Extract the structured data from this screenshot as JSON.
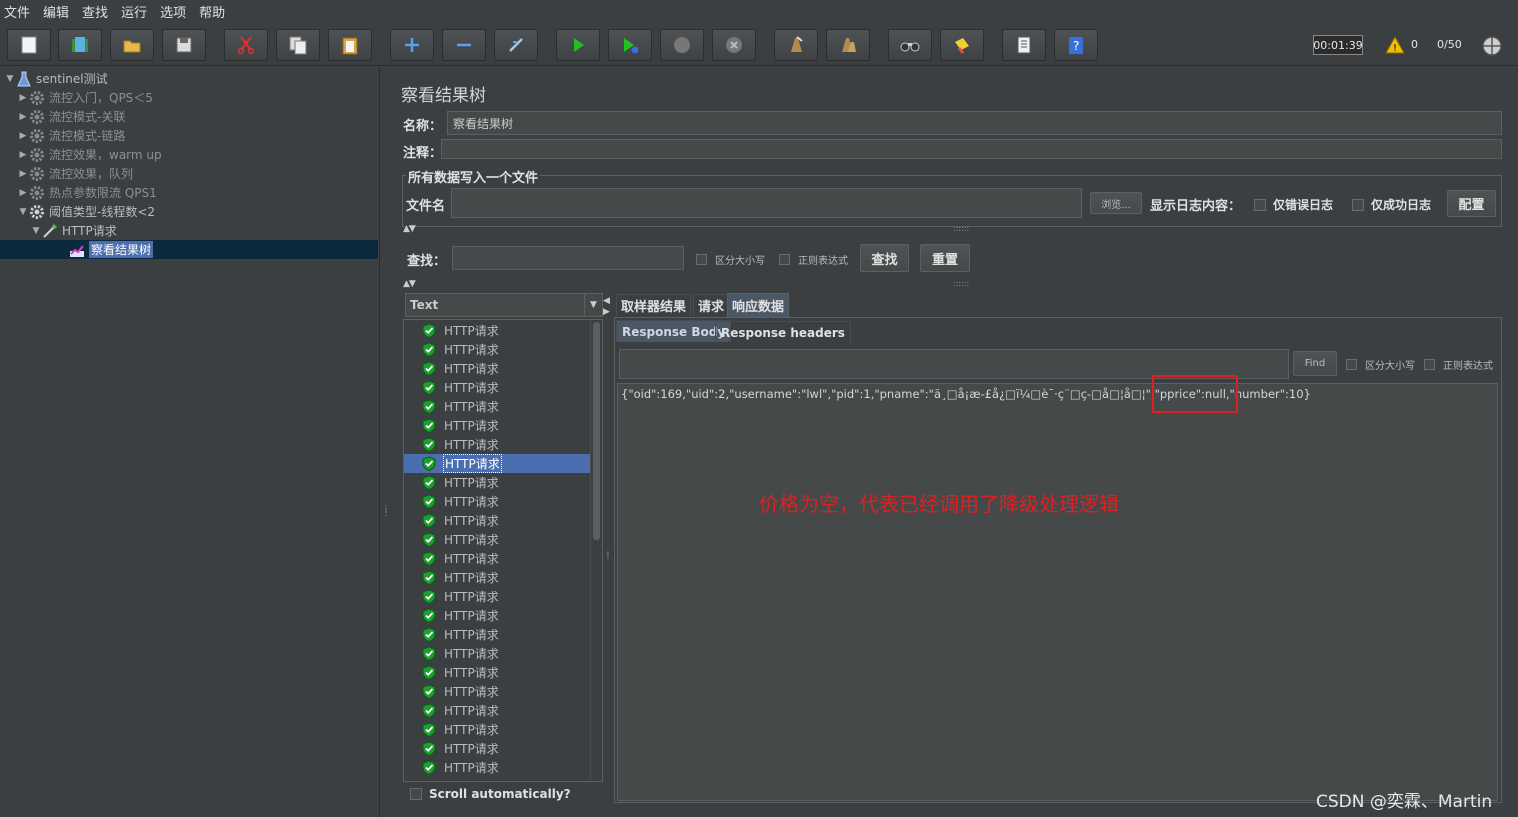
{
  "menu": [
    "文件",
    "编辑",
    "查找",
    "运行",
    "选项",
    "帮助"
  ],
  "toolbar": {
    "buttons": [
      "new-icon",
      "templates-icon",
      "open-icon",
      "save-icon",
      "cut-icon",
      "copy-icon",
      "paste-icon",
      "expand-icon",
      "collapse-icon",
      "toggle-icon",
      "start-icon",
      "start-no-pause-icon",
      "stop-icon",
      "shutdown-icon",
      "clear-icon",
      "clear-all-icon",
      "search-icon",
      "reset-search-icon",
      "function-helper-icon",
      "help-icon"
    ],
    "timer": "00:01:39",
    "warning_count": "0",
    "threads": "0/50",
    "colors": {
      "accent_green": "#20c020",
      "warning": "#f0c000",
      "help_blue": "#3a6fd8"
    }
  },
  "tree": [
    {
      "label": "sentinel测试",
      "level": 0,
      "expanded": true,
      "icon": "flask-icon",
      "disabled": false
    },
    {
      "label": "流控入门，QPS＜5",
      "level": 1,
      "expanded": false,
      "icon": "gear-icon",
      "disabled": true
    },
    {
      "label": "流控模式-关联",
      "level": 1,
      "expanded": false,
      "icon": "gear-icon",
      "disabled": true
    },
    {
      "label": "流控模式-链路",
      "level": 1,
      "expanded": false,
      "icon": "gear-icon",
      "disabled": true
    },
    {
      "label": "流控效果，warm up",
      "level": 1,
      "expanded": false,
      "icon": "gear-icon",
      "disabled": true
    },
    {
      "label": "流控效果，队列",
      "level": 1,
      "expanded": false,
      "icon": "gear-icon",
      "disabled": true
    },
    {
      "label": "热点参数限流 QPS1",
      "level": 1,
      "expanded": false,
      "icon": "gear-icon",
      "disabled": true
    },
    {
      "label": "阈值类型-线程数<2",
      "level": 1,
      "expanded": true,
      "icon": "gear-icon",
      "disabled": false
    },
    {
      "label": "HTTP请求",
      "level": 2,
      "expanded": true,
      "icon": "pipette-icon",
      "disabled": false
    },
    {
      "label": "察看结果树",
      "level": 3,
      "expanded": false,
      "icon": "chart-icon",
      "disabled": false,
      "selected": true
    }
  ],
  "panel": {
    "title": "察看结果树",
    "name_label": "名称：",
    "name_value": "察看结果树",
    "comment_label": "注释：",
    "comment_value": "",
    "file_group_title": "所有数据写入一个文件",
    "filename_label": "文件名",
    "filename_value": "",
    "browse_button": "浏览...",
    "log_label": "显示日志内容：",
    "errors_only": "仅错误日志",
    "success_only": "仅成功日志",
    "configure_button": "配置",
    "search_label": "查找：",
    "search_value": "",
    "case_sensitive": "区分大小写",
    "regex": "正则表达式",
    "find_button": "查找",
    "reset_button": "重置"
  },
  "results": {
    "renderer": "Text",
    "items": [
      "HTTP请求",
      "HTTP请求",
      "HTTP请求",
      "HTTP请求",
      "HTTP请求",
      "HTTP请求",
      "HTTP请求",
      "HTTP请求",
      "HTTP请求",
      "HTTP请求",
      "HTTP请求",
      "HTTP请求",
      "HTTP请求",
      "HTTP请求",
      "HTTP请求",
      "HTTP请求",
      "HTTP请求",
      "HTTP请求",
      "HTTP请求",
      "HTTP请求",
      "HTTP请求",
      "HTTP请求",
      "HTTP请求",
      "HTTP请求"
    ],
    "selected_index": 7,
    "scroll_auto": "Scroll automatically?"
  },
  "tabs": [
    "取样器结果",
    "请求",
    "响应数据"
  ],
  "active_tab": 2,
  "subtabs": [
    "Response Body",
    "Response headers"
  ],
  "active_subtab": 0,
  "response": {
    "find_button": "Find",
    "case_sensitive": "区分大小写",
    "regex": "正则表达式",
    "body_before": "{\"oid\":169,\"uid\":2,\"username\":\"lwl\",\"pid\":1,\"pname\":\"ä¸□å¡æ-£å¿□ï¼□è¯·ç¨□ç-□å□¦å□¦\",",
    "body_highlight": "\"pprice\":null,\"",
    "body_after": "number\":10}",
    "annotation": "价格为空，代表已经调用了降级处理逻辑"
  },
  "watermark": "CSDN @奕霖、Martin"
}
